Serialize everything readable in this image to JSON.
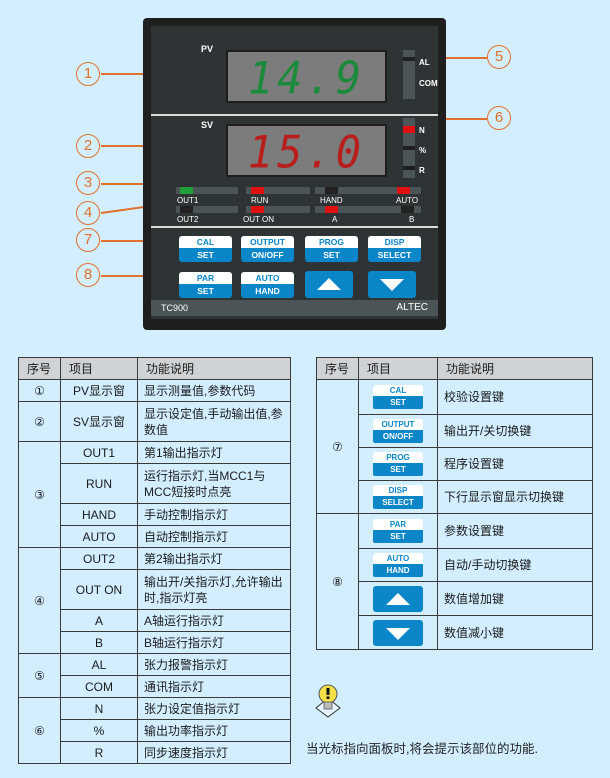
{
  "panel": {
    "pv_label": "PV",
    "sv_label": "SV",
    "pv_value": "14.9",
    "sv_value": "15.0",
    "model": "TC900",
    "brand": "ALTEC",
    "side_indicators_top": [
      "AL",
      "COM"
    ],
    "side_indicators_bottom": [
      "N",
      "%",
      "R"
    ],
    "row1_indicators": [
      "OUT1",
      "RUN",
      "HAND",
      "AUTO"
    ],
    "row2_indicators": [
      "OUT2",
      "OUT ON",
      "A",
      "B"
    ],
    "keys_row1": [
      {
        "top": "CAL",
        "bottom": "SET"
      },
      {
        "top": "OUTPUT",
        "bottom": "ON/OFF"
      },
      {
        "top": "PROG",
        "bottom": "SET"
      },
      {
        "top": "DISP",
        "bottom": "SELECT"
      }
    ],
    "keys_row2": [
      {
        "top": "PAR",
        "bottom": "SET"
      },
      {
        "top": "AUTO",
        "bottom": "HAND"
      }
    ],
    "arrow_keys": [
      "up-arrow",
      "down-arrow"
    ],
    "colors": {
      "pv_digits": "#1b8a3a",
      "sv_digits": "#b81e1e",
      "led_red": "#e01010",
      "led_green": "#1fa03a",
      "key_blue": "#0a86c9",
      "callout": "#e0702a"
    }
  },
  "callouts": [
    "1",
    "2",
    "3",
    "4",
    "5",
    "6",
    "7",
    "8"
  ],
  "left_table": {
    "headers": [
      "序号",
      "项目",
      "功能说明"
    ],
    "groups": [
      {
        "num": "①",
        "rows": [
          {
            "item": "PV显示窗",
            "desc": "显示测量值,参数代码"
          }
        ]
      },
      {
        "num": "②",
        "rows": [
          {
            "item": "SV显示窗",
            "desc": "显示设定值,手动输出值,参数值"
          }
        ]
      },
      {
        "num": "③",
        "rows": [
          {
            "item": "OUT1",
            "desc": "第1输出指示灯"
          },
          {
            "item": "RUN",
            "desc": "运行指示灯,当MCC1与MCC短接时点亮"
          },
          {
            "item": "HAND",
            "desc": "手动控制指示灯"
          },
          {
            "item": "AUTO",
            "desc": "自动控制指示灯"
          }
        ]
      },
      {
        "num": "④",
        "rows": [
          {
            "item": "OUT2",
            "desc": "第2输出指示灯"
          },
          {
            "item": "OUT ON",
            "desc": "输出开/关指示灯,允许输出时,指示灯亮"
          },
          {
            "item": "A",
            "desc": "A轴运行指示灯"
          },
          {
            "item": "B",
            "desc": "B轴运行指示灯"
          }
        ]
      },
      {
        "num": "⑤",
        "rows": [
          {
            "item": "AL",
            "desc": "张力报警指示灯"
          },
          {
            "item": "COM",
            "desc": "通讯指示灯"
          }
        ]
      },
      {
        "num": "⑥",
        "rows": [
          {
            "item": "N",
            "desc": "张力设定值指示灯"
          },
          {
            "item": "%",
            "desc": "输出功率指示灯"
          },
          {
            "item": "R",
            "desc": "同步速度指示灯"
          }
        ]
      }
    ]
  },
  "right_table": {
    "headers": [
      "序号",
      "项目",
      "功能说明"
    ],
    "groups": [
      {
        "num": "⑦",
        "rows": [
          {
            "key_top": "CAL",
            "key_bottom": "SET",
            "desc": "校验设置键"
          },
          {
            "key_top": "OUTPUT",
            "key_bottom": "ON/OFF",
            "desc": "输出开/关切换键"
          },
          {
            "key_top": "PROG",
            "key_bottom": "SET",
            "desc": "程序设置键"
          },
          {
            "key_top": "DISP",
            "key_bottom": "SELECT",
            "desc": "下行显示窗显示切换键"
          }
        ]
      },
      {
        "num": "⑧",
        "rows": [
          {
            "key_top": "PAR",
            "key_bottom": "SET",
            "desc": "参数设置键"
          },
          {
            "key_top": "AUTO",
            "key_bottom": "HAND",
            "desc": "自动/手动切换键"
          },
          {
            "arrow": "up",
            "desc": "数值增加键"
          },
          {
            "arrow": "down",
            "desc": "数值减小键"
          }
        ]
      }
    ]
  },
  "tip": {
    "icon": "lightbulb-warning-icon",
    "text": "当光标指向面板时,将会提示该部位的功能."
  }
}
